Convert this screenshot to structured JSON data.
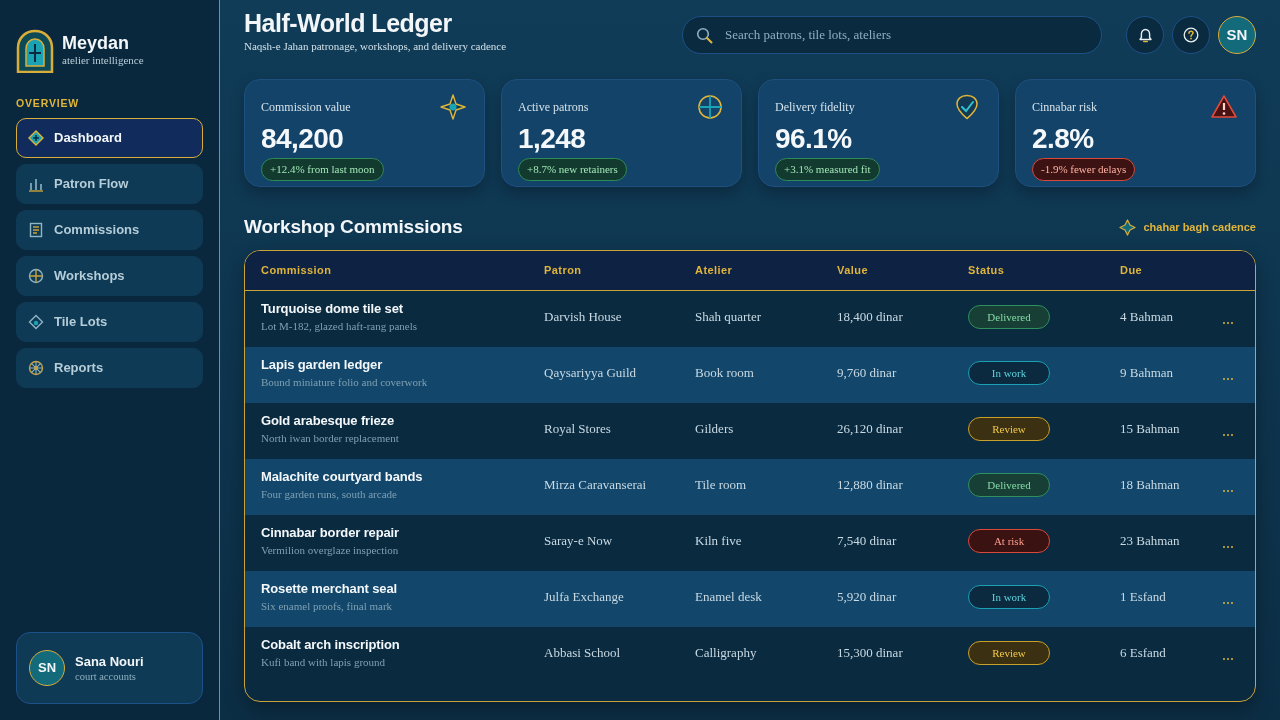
{
  "brand": {
    "name": "Meydan",
    "tagline": "atelier intelligence"
  },
  "sidebar": {
    "section": "OVERVIEW",
    "items": [
      {
        "label": "Dashboard",
        "selected": true
      },
      {
        "label": "Patron Flow",
        "selected": false
      },
      {
        "label": "Commissions",
        "selected": false
      },
      {
        "label": "Workshops",
        "selected": false
      },
      {
        "label": "Tile Lots",
        "selected": false
      },
      {
        "label": "Reports",
        "selected": false
      }
    ]
  },
  "user_card": {
    "initials": "SN",
    "name": "Sana Nouri",
    "role": "court accounts"
  },
  "header": {
    "title": "Half-World Ledger",
    "subtitle": "Naqsh-e Jahan patronage, workshops, and delivery cadence"
  },
  "search": {
    "placeholder": "Search patrons, tile lots, ateliers"
  },
  "account": {
    "initials": "SN"
  },
  "stats": [
    {
      "label": "Commission value",
      "value": "84,200",
      "change": {
        "text": "+12.4% from last moon",
        "kind": "gain"
      }
    },
    {
      "label": "Active patrons",
      "value": "1,248",
      "change": {
        "text": "+8.7% new retainers",
        "kind": "gain"
      }
    },
    {
      "label": "Delivery fidelity",
      "value": "96.1%",
      "change": {
        "text": "+3.1% measured fit",
        "kind": "gain"
      }
    },
    {
      "label": "Cinnabar risk",
      "value": "2.8%",
      "change": {
        "text": "-1.9% fewer delays",
        "kind": "alert"
      }
    }
  ],
  "commissions": {
    "title": "Workshop Commissions",
    "legend": "chahar bagh cadence",
    "columns": [
      "Commission",
      "Patron",
      "Atelier",
      "Value",
      "Status",
      "Due"
    ],
    "rows": [
      {
        "commission": "Turquoise dome tile set",
        "detail": "Lot M-182, glazed haft-rang panels",
        "patron": "Darvish House",
        "atelier": "Shah quarter",
        "value": "18,400 dinar",
        "status": {
          "label": "Delivered",
          "kind": "delivered"
        },
        "due": "4 Bahman"
      },
      {
        "commission": "Lapis garden ledger",
        "detail": "Bound miniature folio and coverwork",
        "patron": "Qaysariyya Guild",
        "atelier": "Book room",
        "value": "9,760 dinar",
        "status": {
          "label": "In work",
          "kind": "in_work"
        },
        "due": "9 Bahman"
      },
      {
        "commission": "Gold arabesque frieze",
        "detail": "North iwan border replacement",
        "patron": "Royal Stores",
        "atelier": "Gilders",
        "value": "26,120 dinar",
        "status": {
          "label": "Review",
          "kind": "review"
        },
        "due": "15 Bahman"
      },
      {
        "commission": "Malachite courtyard bands",
        "detail": "Four garden runs, south arcade",
        "patron": "Mirza Caravanserai",
        "atelier": "Tile room",
        "value": "12,880 dinar",
        "status": {
          "label": "Delivered",
          "kind": "delivered"
        },
        "due": "18 Bahman"
      },
      {
        "commission": "Cinnabar border repair",
        "detail": "Vermilion overglaze inspection",
        "patron": "Saray-e Now",
        "atelier": "Kiln five",
        "value": "7,540 dinar",
        "status": {
          "label": "At risk",
          "kind": "at_risk"
        },
        "due": "23 Bahman"
      },
      {
        "commission": "Rosette merchant seal",
        "detail": "Six enamel proofs, final mark",
        "patron": "Julfa Exchange",
        "atelier": "Enamel desk",
        "value": "5,920 dinar",
        "status": {
          "label": "In work",
          "kind": "in_work"
        },
        "due": "1 Esfand"
      },
      {
        "commission": "Cobalt arch inscription",
        "detail": "Kufi band with lapis ground",
        "patron": "Abbasi School",
        "atelier": "Calligraphy",
        "value": "15,300 dinar",
        "status": {
          "label": "Review",
          "kind": "review"
        },
        "due": "6 Esfand"
      }
    ]
  }
}
